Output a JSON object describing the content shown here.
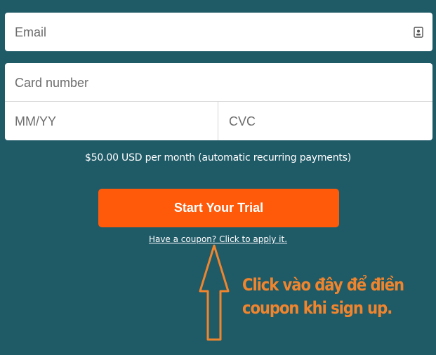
{
  "form": {
    "email_placeholder": "Email",
    "card_number_placeholder": "Card number",
    "expiry_placeholder": "MM/YY",
    "cvc_placeholder": "CVC"
  },
  "pricing": {
    "note": "$50.00 USD per month (automatic recurring payments)"
  },
  "cta": {
    "label": "Start Your Trial",
    "color": "#ff5a0a"
  },
  "coupon": {
    "link_text": "Have a coupon? Click to apply it."
  },
  "annotation": {
    "line1": "Click vào đây để điền",
    "line2": "coupon khi sign up.",
    "color": "#f0852d"
  },
  "icons": {
    "email_field_icon": "autofill-contact-icon",
    "annotation_arrow": "up-arrow-icon"
  },
  "colors": {
    "background": "#1f5a67",
    "field_background": "#ffffff"
  }
}
